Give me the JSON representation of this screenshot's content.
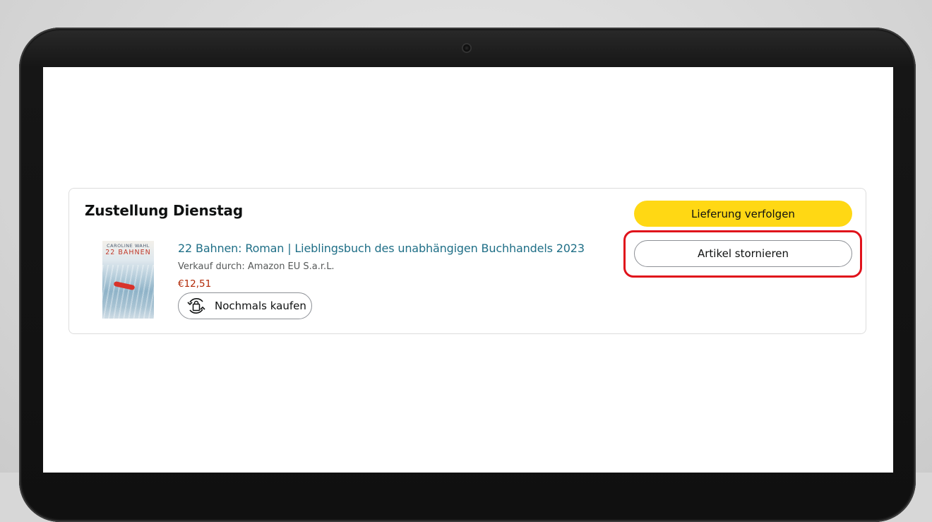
{
  "order": {
    "delivery_heading": "Zustellung Dienstag",
    "item": {
      "cover": {
        "author": "CAROLINE WAHL",
        "title": "22 BAHNEN"
      },
      "title": "22 Bahnen: Roman | Lieblingsbuch des unabhängigen Buchhandels 2023",
      "seller": "Verkauf durch: Amazon EU S.a.r.L.",
      "price": "€12,51",
      "rebuy_label": "Nochmals kaufen"
    },
    "actions": {
      "track_label": "Lieferung verfolgen",
      "cancel_label": "Artikel stornieren"
    }
  },
  "colors": {
    "primary_button": "#ffd814",
    "link": "#1f6f87",
    "price": "#b12704",
    "highlight": "#e0121b"
  }
}
